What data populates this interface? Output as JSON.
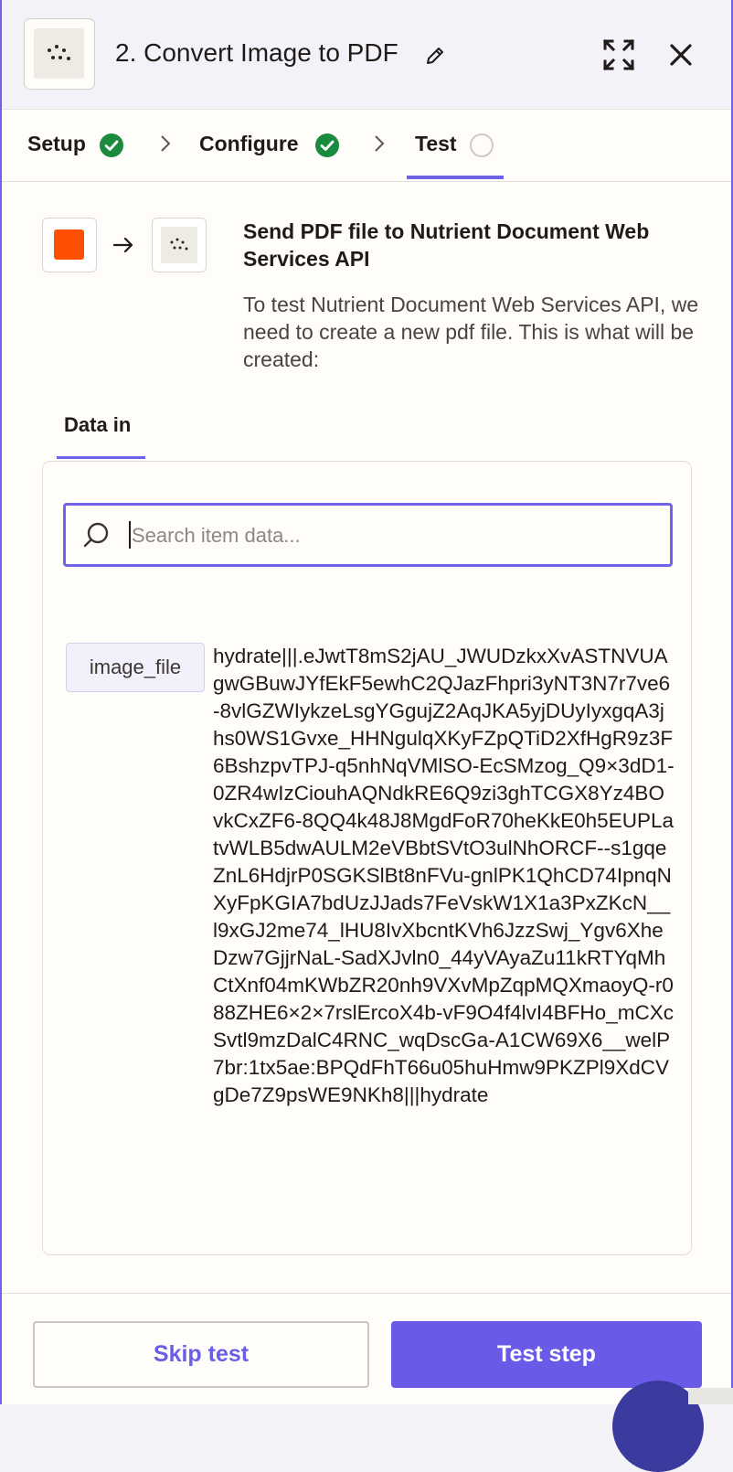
{
  "header": {
    "title": "2. Convert Image to PDF",
    "icons": {
      "app": "nutrient-dots-logo",
      "edit": "pencil-icon",
      "expand": "expand-icon",
      "close": "close-icon"
    }
  },
  "steps": [
    {
      "label": "Setup",
      "status": "complete"
    },
    {
      "label": "Configure",
      "status": "complete"
    },
    {
      "label": "Test",
      "status": "active"
    }
  ],
  "colors": {
    "accent": "#6f63e6",
    "success": "#1a8a3c",
    "source_app": "#ff4f00"
  },
  "flow": {
    "title": "Send PDF file to Nutrient Document Web Services API",
    "description": "To test Nutrient Document Web Services API, we need to create a new pdf file. This is what will be created:"
  },
  "data_in": {
    "tab_label": "Data in",
    "search": {
      "placeholder": "Search item data...",
      "value": ""
    },
    "fields": [
      {
        "key": "image_file",
        "value": "hydrate|||.eJwtT8mS2jAU_JWUDzkxXvASTNVUAgwGBuwJYfEkF5ewhC2QJazFhpri3yNT3N7r7ve6-8vlGZWIykzeLsgYGgujZ2AqJKA5yjDUyIyxgqA3jhs0WS1Gvxe_HHNgulqXKyFZpQTiD2XfHgR9z3F6BshzpvTPJ-q5nhNqVMlSO-EcSMzog_Q9×3dD1-0ZR4wIzCiouhAQNdkRE6Q9zi3ghTCGX8Yz4BOvkCxZF6-8QQ4k48J8MgdFoR70heKkE0h5EUPLatvWLB5dwAULM2eVBbtSVtO3ulNhORCF--s1gqeZnL6HdjrP0SGKSlBt8nFVu-gnlPK1QhCD74IpnqNXyFpKGIA7bdUzJJads7FeVskW1X1a3PxZKcN__l9xGJ2me74_lHU8IvXbcntKVh6JzzSwj_Ygv6XheDzw7GjjrNaL-SadXJvln0_44yVAyaZu11kRTYqMhCtXnf04mKWbZR20nh9VXvMpZqpMQXmaoyQ-r088ZHE6×2×7rslErcoX4b-vF9O4f4lvI4BFHo_mCXcSvtl9mzDalC4RNC_wqDscGa-A1CW69X6__welP7br:1tx5ae:BPQdFhT66u05huHmw9PKZPl9XdCVgDe7Z9psWE9NKh8|||hydrate"
      }
    ]
  },
  "footer": {
    "skip_label": "Skip test",
    "test_label": "Test step"
  }
}
